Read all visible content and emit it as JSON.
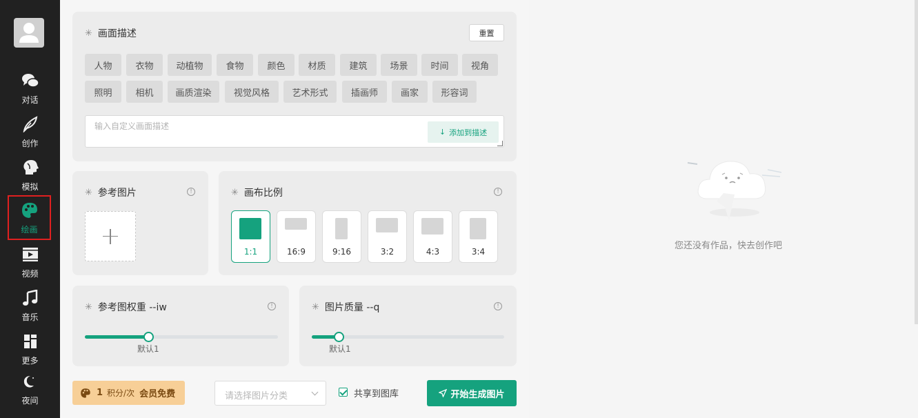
{
  "sidebar": {
    "items": [
      {
        "label": "对话",
        "icon": "chat-bubbles-icon"
      },
      {
        "label": "创作",
        "icon": "feather-icon"
      },
      {
        "label": "模拟",
        "icon": "head-profile-icon"
      },
      {
        "label": "绘画",
        "icon": "palette-icon"
      },
      {
        "label": "视频",
        "icon": "video-play-icon"
      },
      {
        "label": "音乐",
        "icon": "music-note-icon"
      },
      {
        "label": "更多",
        "icon": "grid-icon"
      },
      {
        "label": "夜间",
        "icon": "moon-icon"
      }
    ],
    "active": "绘画"
  },
  "description": {
    "title": "画面描述",
    "reset_label": "重置",
    "tags": [
      "人物",
      "衣物",
      "动植物",
      "食物",
      "颜色",
      "材质",
      "建筑",
      "场景",
      "时间",
      "视角",
      "照明",
      "相机",
      "画质渲染",
      "视觉风格",
      "艺术形式",
      "插画师",
      "画家",
      "形容词"
    ],
    "input_placeholder": "输入自定义画面描述",
    "add_label": "添加到描述"
  },
  "reference": {
    "title": "参考图片"
  },
  "canvas": {
    "title": "画布比例",
    "ratios": [
      "1:1",
      "16:9",
      "9:16",
      "3:2",
      "4:3",
      "3:4"
    ],
    "selected": "1:1"
  },
  "weight": {
    "title": "参考图权重 --iw",
    "hint": "默认1",
    "value_fraction": 0.33
  },
  "quality": {
    "title": "图片质量 --q",
    "hint": "默认1",
    "value_fraction": 0.14
  },
  "footer": {
    "cost_num": "1",
    "cost_unit": "积分/次",
    "vip_label": "会员免费",
    "category_placeholder": "请选择图片分类",
    "share_label": "共享到图库",
    "share_checked": true,
    "generate_label": "开始生成图片"
  },
  "works": {
    "empty_text": "您还没有作品，快去创作吧"
  },
  "colors": {
    "accent": "#15a27e",
    "sidebar_bg": "#212121",
    "cost_bg": "#f7cf97",
    "highlight_outline": "#e02020"
  }
}
